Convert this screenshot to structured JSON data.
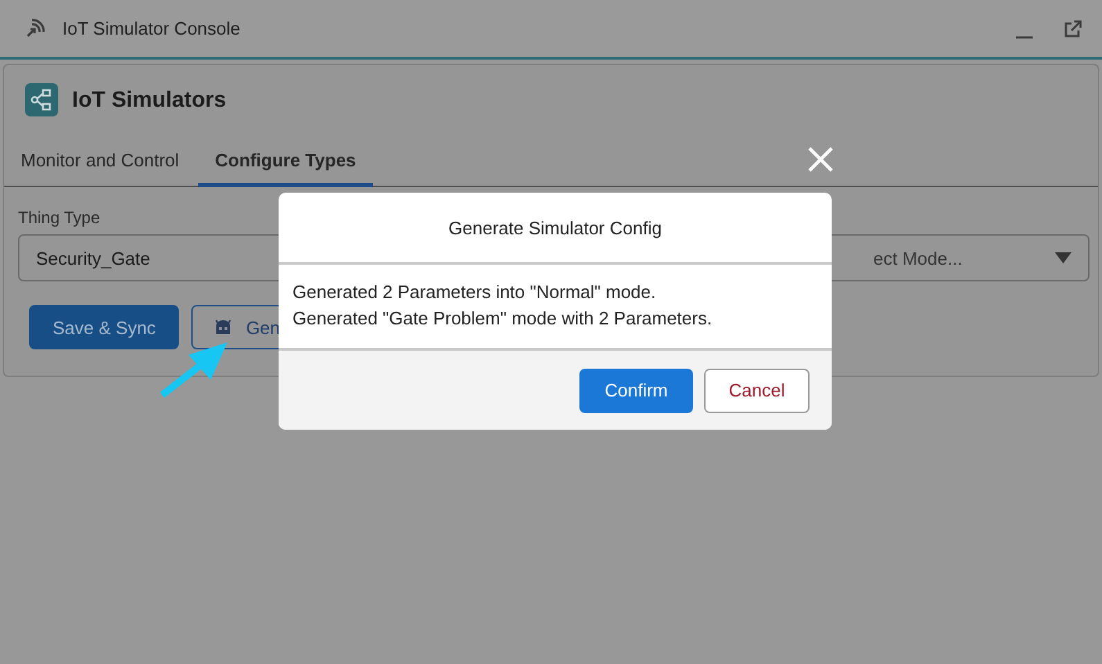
{
  "window": {
    "title": "IoT Simulator Console"
  },
  "app": {
    "title": "IoT Simulators"
  },
  "tabs": [
    {
      "label": "Monitor and Control",
      "selected": false
    },
    {
      "label": "Configure Types",
      "selected": true
    }
  ],
  "thing_type": {
    "label": "Thing Type",
    "value": "Security_Gate"
  },
  "mode_select": {
    "placeholder": "ect Mode..."
  },
  "buttons": [
    {
      "label": "Save & Sync",
      "kind": "primary"
    },
    {
      "label": "Gen",
      "kind": "generate"
    }
  ],
  "dialog": {
    "title": "Generate Simulator Config",
    "lines": [
      "Generated 2 Parameters into \"Normal\" mode.",
      "Generated \"Gate Problem\" mode with 2 Parameters."
    ],
    "buttons": [
      {
        "label": "Confirm",
        "kind": "brand"
      },
      {
        "label": "Cancel",
        "kind": "neutral"
      }
    ]
  }
}
